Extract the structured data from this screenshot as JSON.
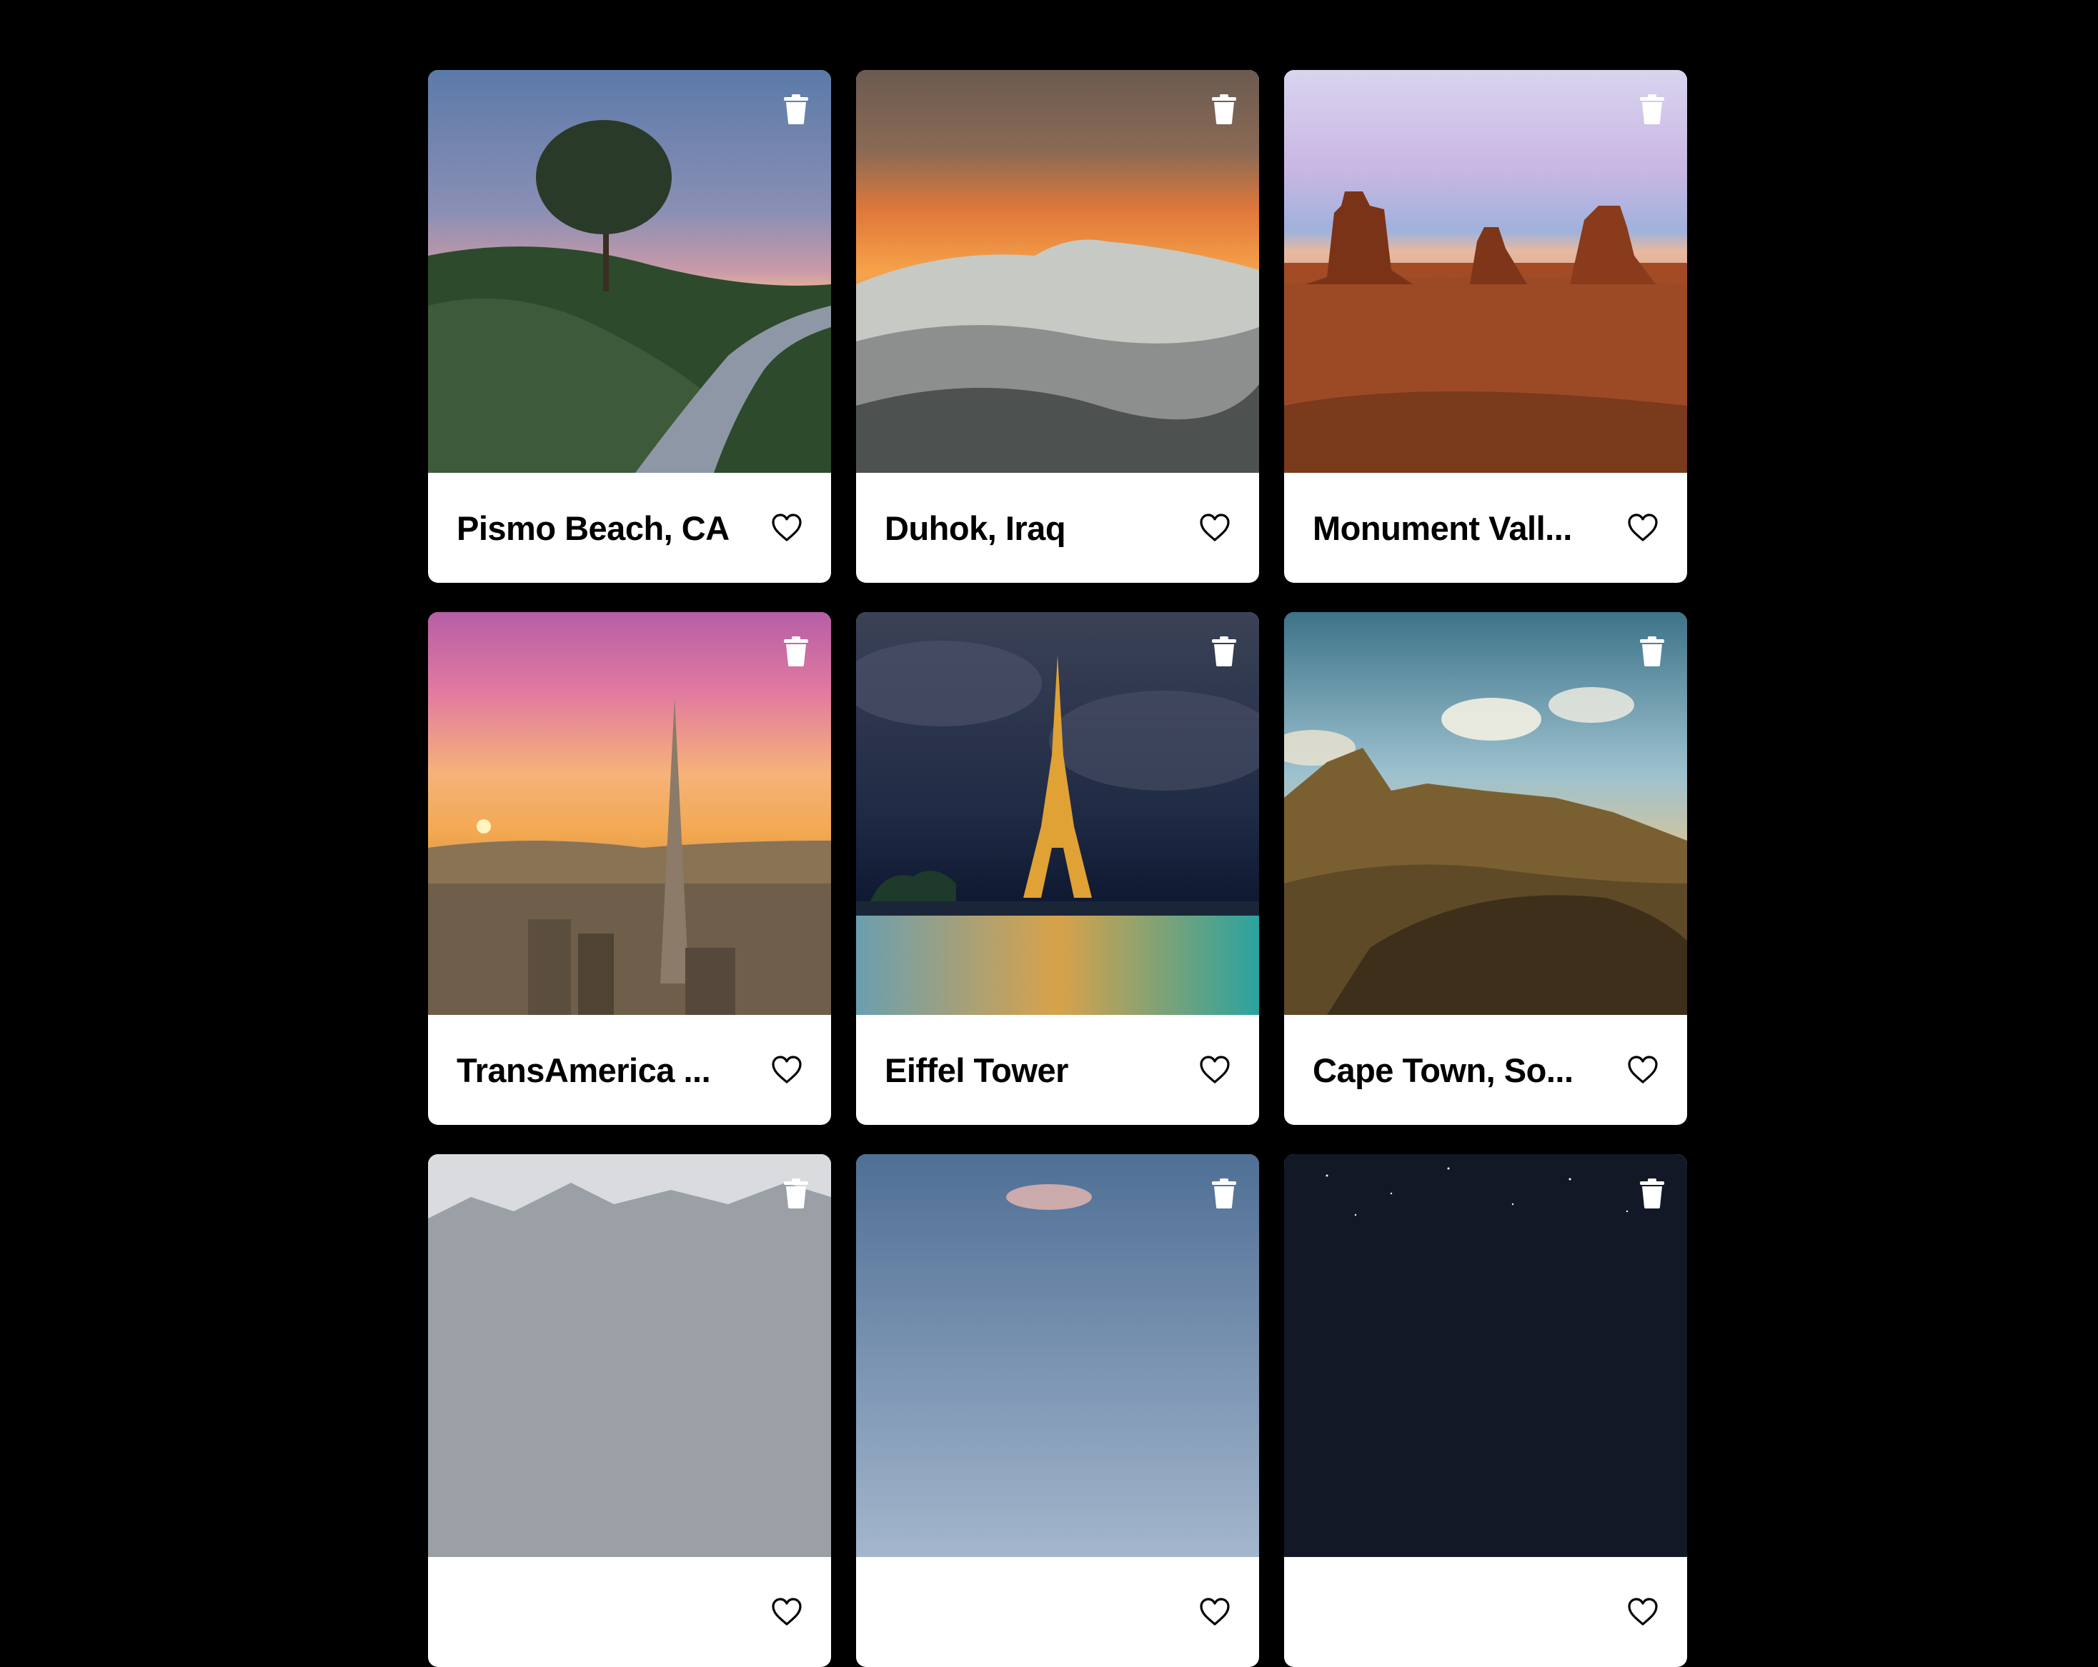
{
  "cards": [
    {
      "title": "Pismo Beach, CA",
      "favorite_icon": "heart-outline-icon",
      "delete_icon": "trash-icon"
    },
    {
      "title": "Duhok, Iraq",
      "favorite_icon": "heart-outline-icon",
      "delete_icon": "trash-icon"
    },
    {
      "title": "Monument Vall...",
      "favorite_icon": "heart-outline-icon",
      "delete_icon": "trash-icon"
    },
    {
      "title": "TransAmerica ...",
      "favorite_icon": "heart-outline-icon",
      "delete_icon": "trash-icon"
    },
    {
      "title": "Eiffel Tower",
      "favorite_icon": "heart-outline-icon",
      "delete_icon": "trash-icon"
    },
    {
      "title": "Cape Town, So...",
      "favorite_icon": "heart-outline-icon",
      "delete_icon": "trash-icon"
    },
    {
      "title": "",
      "favorite_icon": "heart-outline-icon",
      "delete_icon": "trash-icon"
    },
    {
      "title": "",
      "favorite_icon": "heart-outline-icon",
      "delete_icon": "trash-icon"
    },
    {
      "title": "",
      "favorite_icon": "heart-outline-icon",
      "delete_icon": "trash-icon"
    }
  ],
  "colors": {
    "background": "#000000",
    "card": "#ffffff",
    "text": "#000000"
  }
}
